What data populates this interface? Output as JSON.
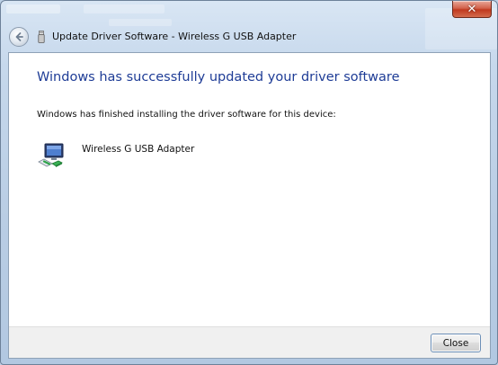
{
  "window": {
    "title": "Update Driver Software - Wireless G USB Adapter",
    "close_glyph": "✕"
  },
  "icons": {
    "back": "back-arrow-icon",
    "app": "usb-device-icon",
    "device": "network-adapter-icon"
  },
  "content": {
    "heading": "Windows has successfully updated your driver software",
    "message": "Windows has finished installing the driver software for this device:",
    "device_name": "Wireless G USB Adapter"
  },
  "footer": {
    "close_label": "Close"
  },
  "colors": {
    "heading": "#1e3c96",
    "frame": "#b9cde4",
    "close_button": "#c0391e"
  }
}
